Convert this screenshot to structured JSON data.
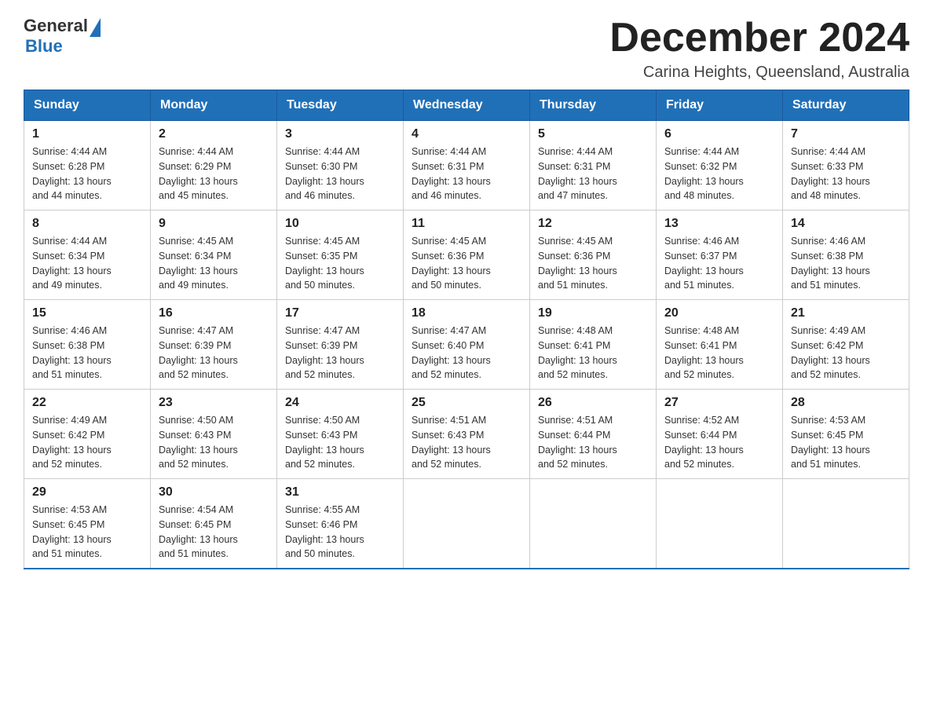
{
  "header": {
    "logo": {
      "general": "General",
      "blue": "Blue"
    },
    "title": "December 2024",
    "location": "Carina Heights, Queensland, Australia"
  },
  "days_of_week": [
    "Sunday",
    "Monday",
    "Tuesday",
    "Wednesday",
    "Thursday",
    "Friday",
    "Saturday"
  ],
  "weeks": [
    [
      {
        "day": "1",
        "sunrise": "4:44 AM",
        "sunset": "6:28 PM",
        "daylight": "13 hours and 44 minutes."
      },
      {
        "day": "2",
        "sunrise": "4:44 AM",
        "sunset": "6:29 PM",
        "daylight": "13 hours and 45 minutes."
      },
      {
        "day": "3",
        "sunrise": "4:44 AM",
        "sunset": "6:30 PM",
        "daylight": "13 hours and 46 minutes."
      },
      {
        "day": "4",
        "sunrise": "4:44 AM",
        "sunset": "6:31 PM",
        "daylight": "13 hours and 46 minutes."
      },
      {
        "day": "5",
        "sunrise": "4:44 AM",
        "sunset": "6:31 PM",
        "daylight": "13 hours and 47 minutes."
      },
      {
        "day": "6",
        "sunrise": "4:44 AM",
        "sunset": "6:32 PM",
        "daylight": "13 hours and 48 minutes."
      },
      {
        "day": "7",
        "sunrise": "4:44 AM",
        "sunset": "6:33 PM",
        "daylight": "13 hours and 48 minutes."
      }
    ],
    [
      {
        "day": "8",
        "sunrise": "4:44 AM",
        "sunset": "6:34 PM",
        "daylight": "13 hours and 49 minutes."
      },
      {
        "day": "9",
        "sunrise": "4:45 AM",
        "sunset": "6:34 PM",
        "daylight": "13 hours and 49 minutes."
      },
      {
        "day": "10",
        "sunrise": "4:45 AM",
        "sunset": "6:35 PM",
        "daylight": "13 hours and 50 minutes."
      },
      {
        "day": "11",
        "sunrise": "4:45 AM",
        "sunset": "6:36 PM",
        "daylight": "13 hours and 50 minutes."
      },
      {
        "day": "12",
        "sunrise": "4:45 AM",
        "sunset": "6:36 PM",
        "daylight": "13 hours and 51 minutes."
      },
      {
        "day": "13",
        "sunrise": "4:46 AM",
        "sunset": "6:37 PM",
        "daylight": "13 hours and 51 minutes."
      },
      {
        "day": "14",
        "sunrise": "4:46 AM",
        "sunset": "6:38 PM",
        "daylight": "13 hours and 51 minutes."
      }
    ],
    [
      {
        "day": "15",
        "sunrise": "4:46 AM",
        "sunset": "6:38 PM",
        "daylight": "13 hours and 51 minutes."
      },
      {
        "day": "16",
        "sunrise": "4:47 AM",
        "sunset": "6:39 PM",
        "daylight": "13 hours and 52 minutes."
      },
      {
        "day": "17",
        "sunrise": "4:47 AM",
        "sunset": "6:39 PM",
        "daylight": "13 hours and 52 minutes."
      },
      {
        "day": "18",
        "sunrise": "4:47 AM",
        "sunset": "6:40 PM",
        "daylight": "13 hours and 52 minutes."
      },
      {
        "day": "19",
        "sunrise": "4:48 AM",
        "sunset": "6:41 PM",
        "daylight": "13 hours and 52 minutes."
      },
      {
        "day": "20",
        "sunrise": "4:48 AM",
        "sunset": "6:41 PM",
        "daylight": "13 hours and 52 minutes."
      },
      {
        "day": "21",
        "sunrise": "4:49 AM",
        "sunset": "6:42 PM",
        "daylight": "13 hours and 52 minutes."
      }
    ],
    [
      {
        "day": "22",
        "sunrise": "4:49 AM",
        "sunset": "6:42 PM",
        "daylight": "13 hours and 52 minutes."
      },
      {
        "day": "23",
        "sunrise": "4:50 AM",
        "sunset": "6:43 PM",
        "daylight": "13 hours and 52 minutes."
      },
      {
        "day": "24",
        "sunrise": "4:50 AM",
        "sunset": "6:43 PM",
        "daylight": "13 hours and 52 minutes."
      },
      {
        "day": "25",
        "sunrise": "4:51 AM",
        "sunset": "6:43 PM",
        "daylight": "13 hours and 52 minutes."
      },
      {
        "day": "26",
        "sunrise": "4:51 AM",
        "sunset": "6:44 PM",
        "daylight": "13 hours and 52 minutes."
      },
      {
        "day": "27",
        "sunrise": "4:52 AM",
        "sunset": "6:44 PM",
        "daylight": "13 hours and 52 minutes."
      },
      {
        "day": "28",
        "sunrise": "4:53 AM",
        "sunset": "6:45 PM",
        "daylight": "13 hours and 51 minutes."
      }
    ],
    [
      {
        "day": "29",
        "sunrise": "4:53 AM",
        "sunset": "6:45 PM",
        "daylight": "13 hours and 51 minutes."
      },
      {
        "day": "30",
        "sunrise": "4:54 AM",
        "sunset": "6:45 PM",
        "daylight": "13 hours and 51 minutes."
      },
      {
        "day": "31",
        "sunrise": "4:55 AM",
        "sunset": "6:46 PM",
        "daylight": "13 hours and 50 minutes."
      },
      null,
      null,
      null,
      null
    ]
  ],
  "labels": {
    "sunrise": "Sunrise:",
    "sunset": "Sunset:",
    "daylight": "Daylight:"
  }
}
